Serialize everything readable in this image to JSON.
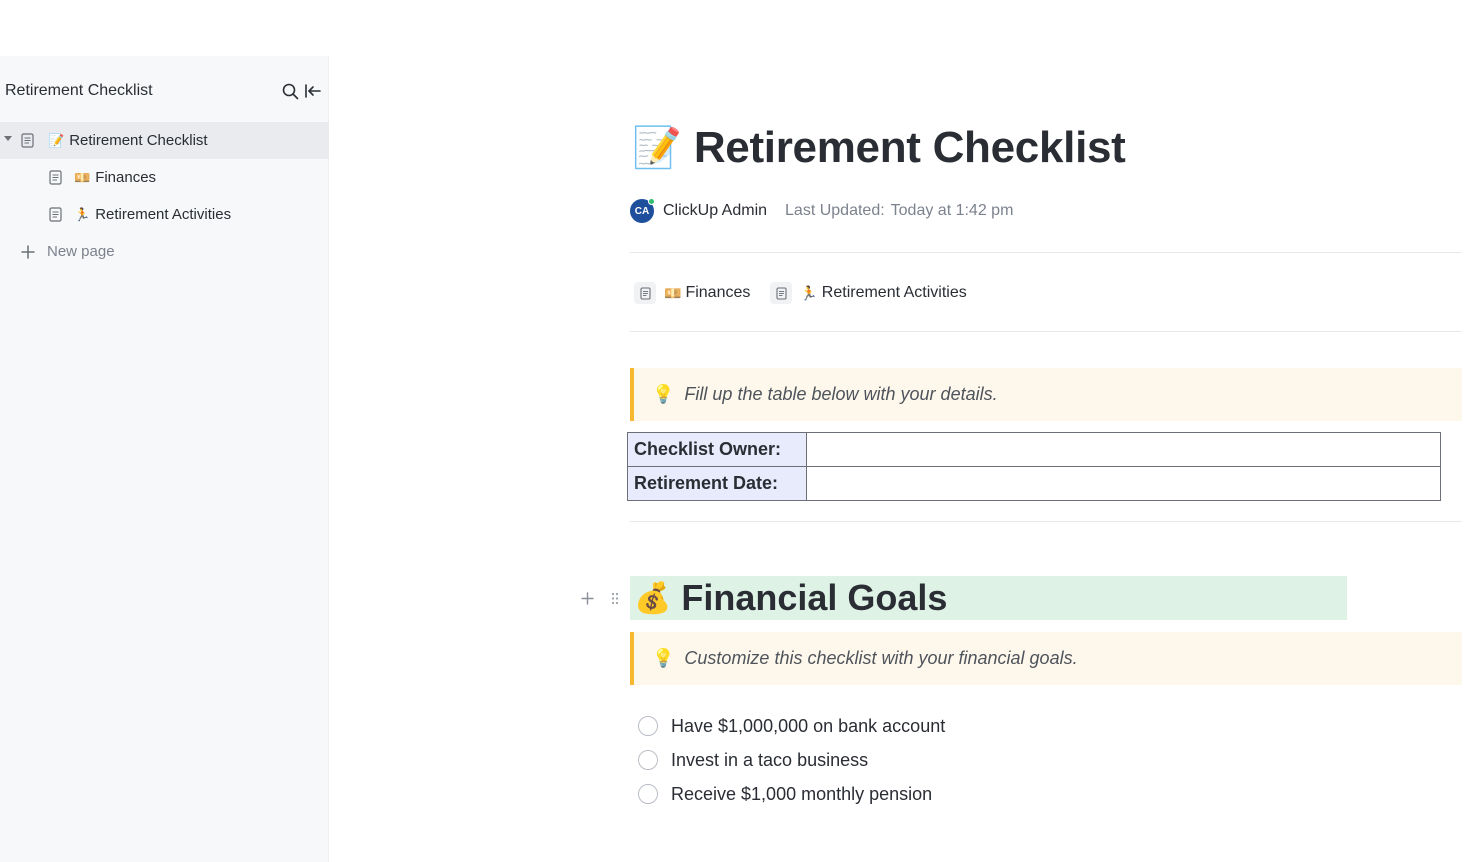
{
  "sidebar": {
    "title": "Retirement Checklist",
    "items": [
      {
        "emoji": "📝",
        "label": "Retirement Checklist"
      },
      {
        "emoji": "💴",
        "label": "Finances"
      },
      {
        "emoji": "🏃",
        "label": "Retirement Activities"
      }
    ],
    "new_page_label": "New page"
  },
  "page": {
    "title_emoji": "📝",
    "title": "Retirement Checklist",
    "author_initials": "CA",
    "author": "ClickUp Admin",
    "last_updated_label": "Last Updated:",
    "last_updated_value": "Today at 1:42 pm"
  },
  "subpages": [
    {
      "emoji": "💴",
      "label": "Finances"
    },
    {
      "emoji": "🏃",
      "label": "Retirement Activities"
    }
  ],
  "callout1": {
    "icon": "💡",
    "text": "Fill up the table below with your details."
  },
  "info_table": [
    {
      "label": "Checklist Owner:",
      "value": ""
    },
    {
      "label": "Retirement Date:",
      "value": ""
    }
  ],
  "section": {
    "emoji": "💰",
    "heading": "Financial Goals"
  },
  "callout2": {
    "icon": "💡",
    "text": "Customize this checklist with your financial goals."
  },
  "checklist": [
    {
      "label": "Have $1,000,000 on bank account",
      "checked": false
    },
    {
      "label": "Invest in a taco business",
      "checked": false
    },
    {
      "label": "Receive $1,000 monthly pension",
      "checked": false
    }
  ],
  "colors": {
    "sidebar_bg": "#f7f8f9",
    "callout_bg": "#fef8ec",
    "callout_border": "#f5b82e",
    "heading_band": "#dff2e6",
    "table_label_bg": "#e8ebfb",
    "avatar_bg": "#1d4f9c"
  }
}
